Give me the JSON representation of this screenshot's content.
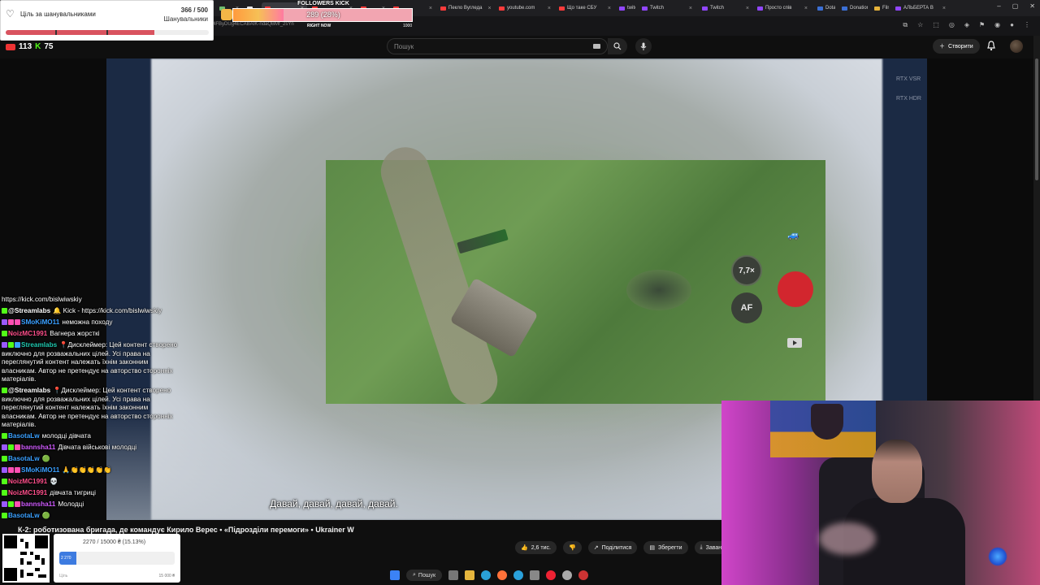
{
  "browser": {
    "tabs": [
      {
        "label": "",
        "color": "#6fbf6f"
      },
      {
        "label": "",
        "color": "#e6e6e6"
      },
      {
        "label": "",
        "color": "#ff3b3b"
      },
      {
        "label": "",
        "color": "#ff3b3b"
      },
      {
        "label": "",
        "color": "#ff3b3b"
      },
      {
        "label": "",
        "color": "#ff3b3b"
      },
      {
        "label": "Пекло Вугледа",
        "color": "#ff3b3b"
      },
      {
        "label": "youtube.com",
        "color": "#ff3b3b"
      },
      {
        "label": "Що таке СБУ",
        "color": "#ff3b3b"
      },
      {
        "label": "twitch",
        "color": "#9146ff"
      },
      {
        "label": "Twitch",
        "color": "#9146ff"
      },
      {
        "label": "Twitch",
        "color": "#9146ff"
      },
      {
        "label": "Просто спів",
        "color": "#9146ff"
      },
      {
        "label": "Dota2",
        "color": "#3b6fd4"
      },
      {
        "label": "Donations",
        "color": "#3b6fd4"
      },
      {
        "label": "Films",
        "color": "#e6b23a"
      },
      {
        "label": "АЛЬБЕРТА В",
        "color": "#9146ff"
      }
    ],
    "url_fragment": "4FByDUg4ECABAIK-ndaQBMf_2sYn"
  },
  "youtube": {
    "search_placeholder": "Пошук",
    "create_label": "Створити",
    "video_title": "К-2: роботизована бригада, де командує Кирило Верес • «Підрозділи перемоги» • Ukrainer W",
    "subtitle": "Давай, давай, давай, давай.",
    "hud": {
      "zoom": "7,7×",
      "af": "AF",
      "rtx1": "RTX VSR",
      "rtx2": "RTX HDR"
    },
    "actions": {
      "likes": "2,6 тис.",
      "share": "Поділитися",
      "save": "Зберегти",
      "download": "Заван"
    }
  },
  "follower_goal": {
    "label": "Ціль за шанувальниками",
    "count": "366 / 500",
    "sublabel": "Шанувальники",
    "progress": 0.732
  },
  "kick_goal": {
    "title": "FOLLOWERS KICK",
    "value": "289 (28%)",
    "progress": 0.28,
    "now_label": "RIGHT NOW",
    "max_label": "1000"
  },
  "viewers": {
    "youtube": "113",
    "kick": "75"
  },
  "chat": [
    {
      "user": "",
      "text": "https://kick.com/bislwiwskiy",
      "user_color": "#ffffff",
      "badges": []
    },
    {
      "user": "@Streamlabs",
      "text": "🔔 Kick - https://kick.com/bislwiwskiy",
      "user_color": "#ffffff",
      "badges": [
        "green"
      ]
    },
    {
      "user": "SMoKiMO11",
      "text": "неможна походу",
      "user_color": "#3aa0ff",
      "badges": [
        "purple",
        "pink",
        "pink"
      ]
    },
    {
      "user": "NoizMC1991",
      "text": "Вагнера жорсткі",
      "user_color": "#ff4f8b",
      "badges": [
        "green"
      ]
    },
    {
      "user": "Streamlabs",
      "text": "📍Дисклеймер: Цей контент створено виключно для розважальних цілей. Усі права на переглянутий контент належать їхнім законним власникам. Автор не претендує на авторство сторонніх матеріалів.",
      "user_color": "#20c9b0",
      "badges": [
        "purple",
        "green",
        "blue"
      ]
    },
    {
      "user": "@Streamlabs",
      "text": "📍Дисклеймер: Цей контент створено виключно для розважальних цілей. Усі права на переглянутий контент належать їхнім законним власникам. Автор не претендує на авторство сторонніх матеріалів.",
      "user_color": "#ffffff",
      "badges": [
        "green"
      ]
    },
    {
      "user": "BasotaLw",
      "text": "молодці дівчата",
      "user_color": "#3aa0ff",
      "badges": [
        "green"
      ]
    },
    {
      "user": "bannsha11",
      "text": "Дівчата військові молодці",
      "user_color": "#d05bff",
      "badges": [
        "purple",
        "green",
        "pink"
      ]
    },
    {
      "user": "BasotaLw",
      "text": "🟢",
      "user_color": "#3aa0ff",
      "badges": [
        "green"
      ]
    },
    {
      "user": "SMoKiMO11",
      "text": "🙏👏👏👏👏👏",
      "user_color": "#3aa0ff",
      "badges": [
        "purple",
        "pink",
        "pink"
      ]
    },
    {
      "user": "NoizMC1991",
      "text": "💀",
      "user_color": "#ff4f8b",
      "badges": [
        "green"
      ]
    },
    {
      "user": "NoizMC1991",
      "text": "дівчата тигриці",
      "user_color": "#ff4f8b",
      "badges": [
        "green"
      ]
    },
    {
      "user": "bannsha11",
      "text": "Молодці",
      "user_color": "#d05bff",
      "badges": [
        "purple",
        "green",
        "pink"
      ]
    },
    {
      "user": "BasotaLw",
      "text": "🟢",
      "user_color": "#3aa0ff",
      "badges": [
        "green"
      ]
    }
  ],
  "donation": {
    "amount": "2270 / 15000 ₴ (15.13%)",
    "fill_label": "2 270",
    "progress": 0.1513,
    "left_label": "Ціль",
    "right_label": "15 000 ₴"
  },
  "taskbar": {
    "search_label": "Пошук"
  }
}
